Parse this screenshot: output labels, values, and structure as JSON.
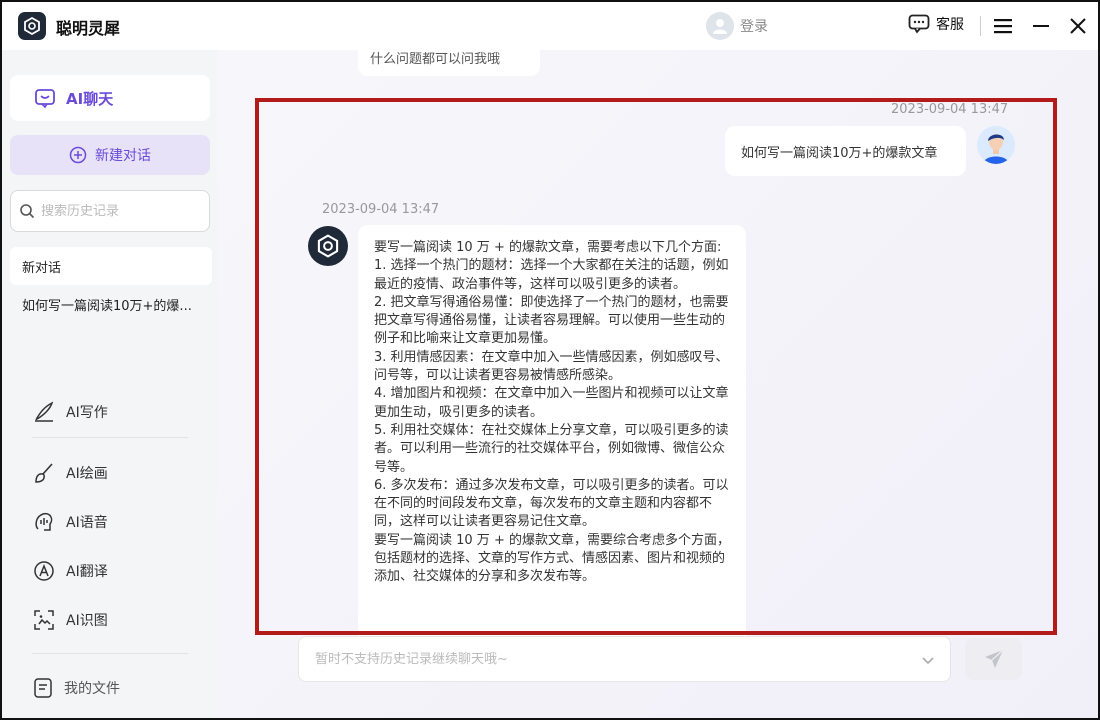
{
  "app": {
    "title": "聪明灵犀"
  },
  "titlebar": {
    "login_label": "登录",
    "service_label": "客服",
    "icons": [
      "app-logo-icon",
      "user-icon",
      "chat-bubble-icon",
      "menu-icon",
      "minimize-icon",
      "close-icon"
    ]
  },
  "sidebar": {
    "chat_label": "AI聊天",
    "new_chat_label": "新建对话",
    "search": {
      "placeholder": "搜索历史记录"
    },
    "history": [
      {
        "label": "新对话",
        "active": true
      },
      {
        "label": "如何写一篇阅读10万+的爆...",
        "active": false
      }
    ],
    "tools": [
      {
        "label": "AI写作",
        "icon": "pen-icon"
      },
      {
        "label": "AI绘画",
        "icon": "paintbrush-icon"
      },
      {
        "label": "AI语音",
        "icon": "voice-icon"
      },
      {
        "label": "AI翻译",
        "icon": "translate-icon"
      },
      {
        "label": "AI识图",
        "icon": "image-scan-icon"
      }
    ],
    "files_label": "我的文件"
  },
  "chat": {
    "previous_fragment": "什么问题都可以问我哦",
    "user_timestamp": "2023-09-04 13:47",
    "user_message": "如何写一篇阅读10万+的爆款文章",
    "bot_timestamp": "2023-09-04 13:47",
    "bot_paragraphs": [
      "要写一篇阅读 10 万 + 的爆款文章，需要考虑以下几个方面:",
      "1. 选择一个热门的题材：选择一个大家都在关注的话题，例如最近的疫情、政治事件等，这样可以吸引更多的读者。",
      "2. 把文章写得通俗易懂：即使选择了一个热门的题材，也需要把文章写得通俗易懂，让读者容易理解。可以使用一些生动的例子和比喻来让文章更加易懂。",
      "3. 利用情感因素：在文章中加入一些情感因素，例如感叹号、问号等，可以让读者更容易被情感所感染。",
      "4. 增加图片和视频：在文章中加入一些图片和视频可以让文章更加生动，吸引更多的读者。",
      "5. 利用社交媒体：在社交媒体上分享文章，可以吸引更多的读者。可以利用一些流行的社交媒体平台，例如微博、微信公众号等。",
      "6. 多次发布：通过多次发布文章，可以吸引更多的读者。可以在不同的时间段发布文章，每次发布的文章主题和内容都不同，这样可以让读者更容易记住文章。",
      "要写一篇阅读 10 万 + 的爆款文章，需要综合考虑多个方面，包括题材的选择、文章的写作方式、情感因素、图片和视频的添加、社交媒体的分享和多次发布等。"
    ]
  },
  "composer": {
    "placeholder": "暂时不支持历史记录继续聊天哦~"
  },
  "colors": {
    "accent": "#6a4bd8",
    "highlight": "#b31b1b",
    "dark": "#1f2937"
  }
}
